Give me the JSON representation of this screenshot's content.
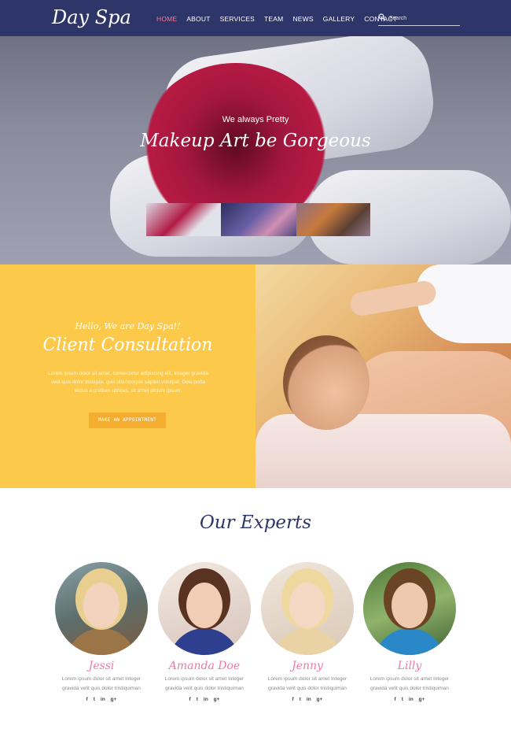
{
  "brand": {
    "logo": "Day Spa"
  },
  "nav": {
    "items": [
      "HOME",
      "ABOUT",
      "SERVICES",
      "TEAM",
      "NEWS",
      "GALLERY",
      "CONTACT"
    ],
    "active_index": 0
  },
  "search": {
    "placeholder": "Search"
  },
  "hero": {
    "subtitle": "We always Pretty",
    "title": "Makeup Art be Gorgeous",
    "thumbnails": 3
  },
  "consultation": {
    "greeting": "Hello, We are Day Spa!!",
    "title": "Client Consultation",
    "text": "Lorem ipsum dolor sit amet, consectetur adipiscing elit. Integer gravida velit quis dolor tristique, quis ullamcorper sapien volutpat. Duis porta lectus a pretium ultrices, sit amet dictum ipsum.",
    "button": "MAKE AN APPOINTMENT"
  },
  "experts": {
    "title": "Our Experts",
    "members": [
      {
        "name": "Jessi",
        "desc": "Lorem ipsum dolor sit amet Integer gravida velit quis dolor tristiquiman"
      },
      {
        "name": "Amanda Doe",
        "desc": "Lorem ipsum dolor sit amet Integer gravida velit quis dolor tristiquiman"
      },
      {
        "name": "Jenny",
        "desc": "Lorem ipsum dolor sit amet Integer gravida velit quis dolor tristiquiman"
      },
      {
        "name": "Lilly",
        "desc": "Lorem ipsum dolor sit amet Integer gravida velit quis dolor tristiquiman"
      }
    ],
    "social_icons": [
      "facebook-icon",
      "twitter-icon",
      "linkedin-icon",
      "google-plus-icon"
    ],
    "social_glyphs": [
      "f",
      "t",
      "in",
      "g+"
    ]
  },
  "colors": {
    "nav_bg": "#2e3568",
    "accent_pink": "#f07aa0",
    "consult_yellow": "#fdc94a",
    "button_orange": "#f4ad2f"
  }
}
